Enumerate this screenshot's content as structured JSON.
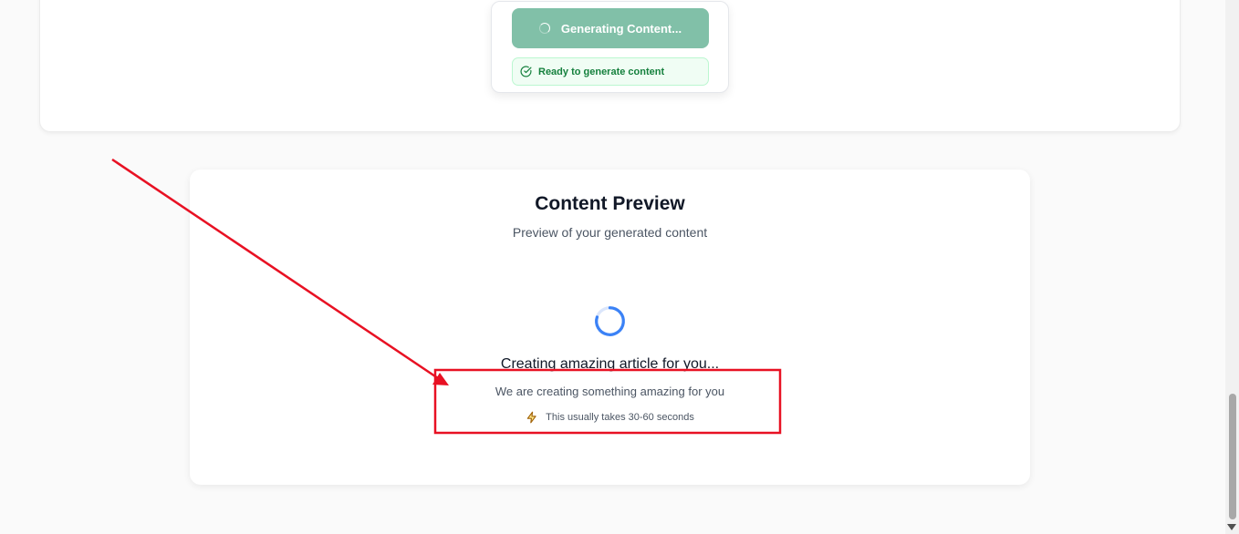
{
  "generate_panel": {
    "button_label": "Generating Content...",
    "status_text": "Ready to generate content"
  },
  "preview": {
    "title": "Content Preview",
    "subtitle": "Preview of your generated content",
    "loading_heading": "Creating amazing article for you...",
    "loading_description": "We are creating something amazing for you",
    "loading_note": "This usually takes 30-60 seconds"
  },
  "colors": {
    "accent_green": "#81c0a8",
    "status_green": "#15803d",
    "spinner_blue": "#3b82f6",
    "annotation_red": "#e81123",
    "bolt_yellow": "#eab308"
  },
  "icons": {
    "button_spinner": "loader-icon",
    "status_check": "check-circle-icon",
    "preview_spinner": "spinner-icon",
    "note_bolt": "lightning-bolt-icon"
  }
}
